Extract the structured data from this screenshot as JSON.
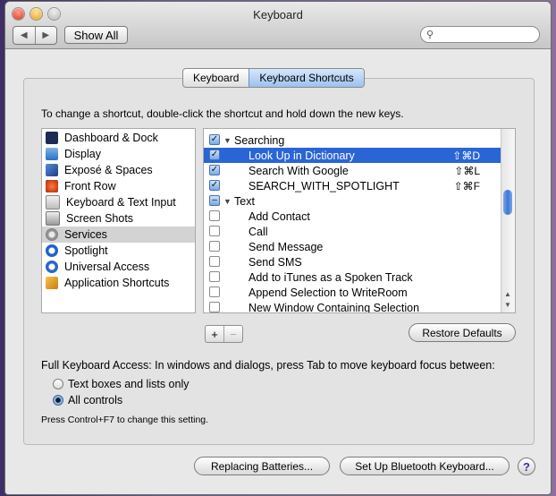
{
  "window": {
    "title": "Keyboard",
    "nav": {
      "back": "◀",
      "forward": "▶"
    },
    "show_all": "Show All",
    "search_placeholder": ""
  },
  "tabs": [
    {
      "label": "Keyboard",
      "active": false
    },
    {
      "label": "Keyboard Shortcuts",
      "active": true
    }
  ],
  "instructions": "To change a shortcut, double-click the shortcut and hold down the new keys.",
  "categories": [
    {
      "label": "Dashboard & Dock",
      "icon": "dashboard-icon"
    },
    {
      "label": "Display",
      "icon": "display-icon"
    },
    {
      "label": "Exposé & Spaces",
      "icon": "expose-icon"
    },
    {
      "label": "Front Row",
      "icon": "front-row-icon"
    },
    {
      "label": "Keyboard & Text Input",
      "icon": "keyboard-icon"
    },
    {
      "label": "Screen Shots",
      "icon": "screenshot-icon"
    },
    {
      "label": "Services",
      "icon": "services-gear-icon",
      "selected": true
    },
    {
      "label": "Spotlight",
      "icon": "spotlight-icon"
    },
    {
      "label": "Universal Access",
      "icon": "universal-access-icon"
    },
    {
      "label": "Application Shortcuts",
      "icon": "application-icon"
    }
  ],
  "shortcuts": [
    {
      "label": "Searching",
      "checked": true,
      "group": true,
      "key": ""
    },
    {
      "label": "Look Up in Dictionary",
      "checked": true,
      "key": "⇧⌘D",
      "selected": true
    },
    {
      "label": "Search With Google",
      "checked": true,
      "key": "⇧⌘L"
    },
    {
      "label": "SEARCH_WITH_SPOTLIGHT",
      "checked": true,
      "key": "⇧⌘F"
    },
    {
      "label": "Text",
      "checked": "mixed",
      "group": true,
      "key": ""
    },
    {
      "label": "Add Contact",
      "checked": false,
      "key": ""
    },
    {
      "label": "Call",
      "checked": false,
      "key": ""
    },
    {
      "label": "Send Message",
      "checked": false,
      "key": ""
    },
    {
      "label": "Send SMS",
      "checked": false,
      "key": ""
    },
    {
      "label": "Add to iTunes as a Spoken Track",
      "checked": false,
      "key": ""
    },
    {
      "label": "Append Selection to WriteRoom",
      "checked": false,
      "key": ""
    },
    {
      "label": "New Window Containing Selection",
      "checked": false,
      "key": ""
    }
  ],
  "controls": {
    "add": "+",
    "remove": "−",
    "restore_defaults": "Restore Defaults"
  },
  "full_keyboard_access": {
    "label": "Full Keyboard Access: In windows and dialogs, press Tab to move keyboard focus between:",
    "options": [
      {
        "label": "Text boxes and lists only",
        "selected": false
      },
      {
        "label": "All controls",
        "selected": true
      }
    ],
    "note": "Press Control+F7 to change this setting."
  },
  "footer": {
    "replacing_batteries": "Replacing Batteries...",
    "bluetooth_setup": "Set Up Bluetooth Keyboard...",
    "help": "?"
  },
  "colors": {
    "selection": "#2a65d6",
    "tab_active": "#9cc1ee"
  }
}
